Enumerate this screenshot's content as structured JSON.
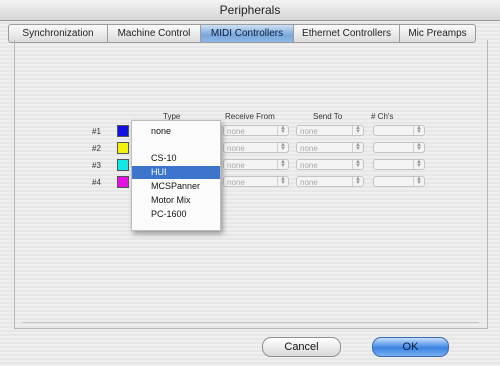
{
  "window": {
    "title": "Peripherals"
  },
  "tabs": [
    {
      "label": "Synchronization",
      "active": false
    },
    {
      "label": "Machine Control",
      "active": false
    },
    {
      "label": "MIDI Controllers",
      "active": true
    },
    {
      "label": "Ethernet Controllers",
      "active": false
    },
    {
      "label": "Mic Preamps",
      "active": false
    }
  ],
  "table": {
    "headers": [
      "Type",
      "Receive From",
      "Send To",
      "# Ch's"
    ],
    "rows": [
      {
        "num": "#1",
        "color": "#1010e0",
        "receive": "none",
        "send": "none"
      },
      {
        "num": "#2",
        "color": "#f2f20e",
        "receive": "none",
        "send": "none"
      },
      {
        "num": "#3",
        "color": "#11e8e8",
        "receive": "none",
        "send": "none"
      },
      {
        "num": "#4",
        "color": "#e410e4",
        "receive": "none",
        "send": "none"
      }
    ]
  },
  "type_menu": {
    "items": [
      "none",
      "CS-10",
      "HUI",
      "MCSPanner",
      "Motor Mix",
      "PC-1600"
    ],
    "highlighted": "HUI"
  },
  "buttons": {
    "cancel": "Cancel",
    "ok": "OK"
  },
  "colors": {
    "accent": "#3d74cc",
    "active_tab": "#7aa8dc"
  }
}
